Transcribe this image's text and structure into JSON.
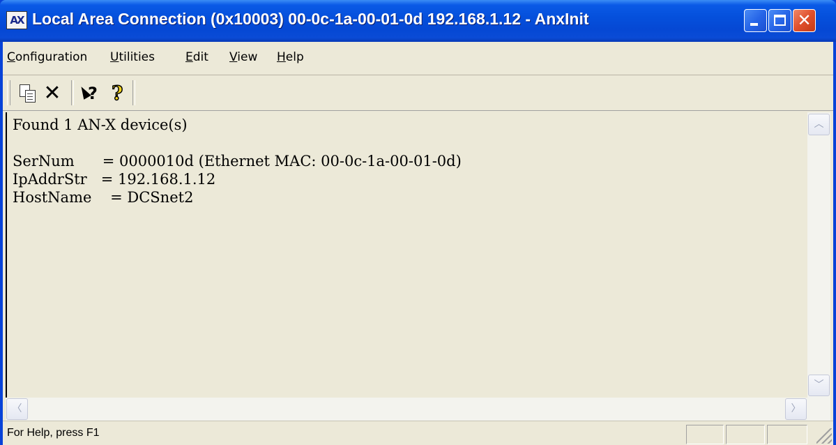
{
  "window": {
    "title": "Local Area Connection (0x10003) 00-0c-1a-00-01-0d  192.168.1.12 - AnxInit",
    "icon_label": "AX",
    "icon": "anxinit-app-icon",
    "caption_buttons": [
      {
        "name": "minimize",
        "icon": "minimize-icon"
      },
      {
        "name": "maximize",
        "icon": "maximize-icon"
      },
      {
        "name": "close",
        "icon": "close-icon",
        "glyph": "✕"
      }
    ]
  },
  "menubar": {
    "items": [
      {
        "label": "Configuration",
        "accel": "C",
        "rest": "onfiguration"
      },
      {
        "label": "Utilities",
        "accel": "U",
        "rest": "tilities"
      },
      {
        "label": "Edit",
        "accel": "E",
        "rest": "dit"
      },
      {
        "label": "View",
        "accel": "V",
        "rest": "iew"
      },
      {
        "label": "Help",
        "accel": "H",
        "rest": "elp"
      }
    ]
  },
  "toolbar": {
    "buttons": [
      {
        "name": "copy",
        "icon": "copy-icon"
      },
      {
        "name": "delete",
        "icon": "delete-icon",
        "glyph": "✕"
      },
      {
        "name": "whats-this",
        "icon": "whats-this-help-icon",
        "glyph": "?"
      },
      {
        "name": "help",
        "icon": "help-icon",
        "glyph": "?"
      }
    ]
  },
  "output": {
    "lines": [
      "Found 1 AN-X device(s)",
      "",
      "SerNum      = 0000010d (Ethernet MAC: 00-0c-1a-00-01-0d)",
      "IpAddrStr   = 192.168.1.12",
      "HostName    = DCSnet2"
    ]
  },
  "scrollbars": {
    "up_arrow": "︿",
    "down_arrow": "﹀",
    "left_arrow": "〈",
    "right_arrow": "〉"
  },
  "statusbar": {
    "text": "For Help, press F1"
  },
  "colors": {
    "titlebar": "#0550dc",
    "window_bg": "#ece9d8",
    "close_button": "#e0502c",
    "help_icon": "#f2d21a"
  }
}
